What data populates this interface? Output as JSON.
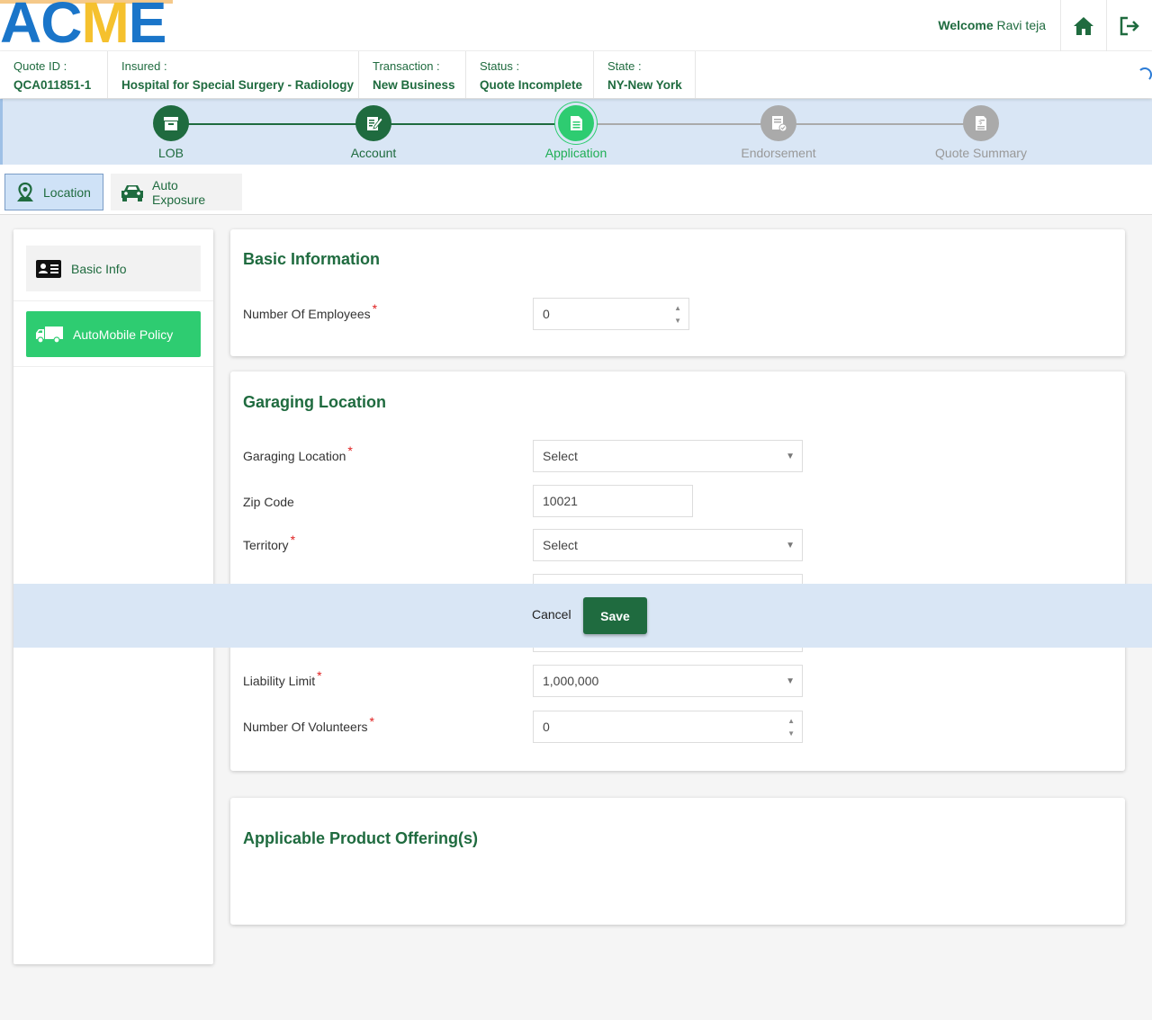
{
  "header": {
    "logo_a": "AC",
    "logo_c": "M",
    "logo_e": "E",
    "welcome_prefix": "Welcome",
    "user_name": "Ravi teja",
    "home_icon": "home-icon",
    "logout_icon": "logout-icon"
  },
  "quote_info": [
    {
      "label": "Quote ID :",
      "value": "QCA011851-1"
    },
    {
      "label": "Insured :",
      "value": "Hospital for Special Surgery - Radiology"
    },
    {
      "label": "Transaction :",
      "value": "New Business"
    },
    {
      "label": "Status :",
      "value": "Quote Incomplete"
    },
    {
      "label": "State :",
      "value": "NY-New York"
    }
  ],
  "stepper": {
    "steps": [
      {
        "label": "LOB",
        "state": "done",
        "icon": "archive-icon"
      },
      {
        "label": "Account",
        "state": "done",
        "icon": "edit-document-icon"
      },
      {
        "label": "Application",
        "state": "active",
        "icon": "document-icon"
      },
      {
        "label": "Endorsement",
        "state": "pending",
        "icon": "certificate-icon"
      },
      {
        "label": "Quote Summary",
        "state": "pending",
        "icon": "invoice-icon"
      }
    ]
  },
  "subtabs": {
    "location": "Location",
    "auto_exposure": "Auto Exposure"
  },
  "left_nav": {
    "basic_info": "Basic Info",
    "automobile_policy": "AutoMobile Policy"
  },
  "basic_information": {
    "title": "Basic Information",
    "num_employees_label": "Number Of Employees",
    "num_employees_value": "0"
  },
  "garaging": {
    "title": "Garaging Location",
    "garaging_location_label": "Garaging Location",
    "garaging_location_value": "Select",
    "zip_label": "Zip Code",
    "zip_value": "10021",
    "territory_label": "Territory",
    "territory_value": "Select",
    "liability_label": "Liability Limit",
    "liability_value": "1,000,000",
    "volunteers_label": "Number Of Volunteers",
    "volunteers_value": "0"
  },
  "products": {
    "title": "Applicable Product Offering(s)"
  },
  "actions": {
    "cancel": "Cancel",
    "save": "Save"
  },
  "colors": {
    "brand_green": "#1f6b3f",
    "active_green": "#2ecc71",
    "stepper_bg": "#d9e6f5",
    "logo_blue": "#1a75c9",
    "logo_yellow": "#f5c12e",
    "required_red": "#e02020"
  }
}
